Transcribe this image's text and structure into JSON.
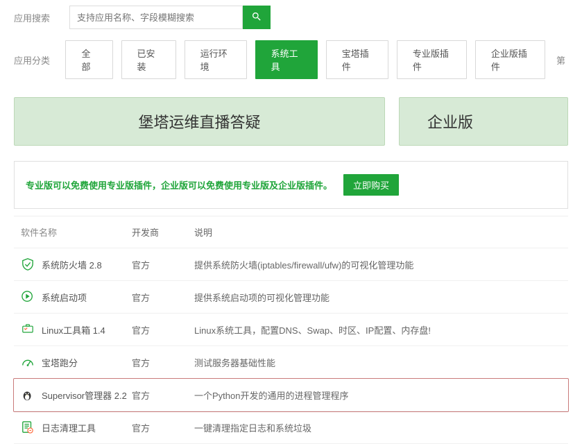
{
  "search": {
    "label": "应用搜索",
    "placeholder": "支持应用名称、字段模糊搜索"
  },
  "categories": {
    "label": "应用分类",
    "items": [
      {
        "label": "全部",
        "active": false
      },
      {
        "label": "已安装",
        "active": false
      },
      {
        "label": "运行环境",
        "active": false
      },
      {
        "label": "系统工具",
        "active": true
      },
      {
        "label": "宝塔插件",
        "active": false
      },
      {
        "label": "专业版插件",
        "active": false
      },
      {
        "label": "企业版插件",
        "active": false
      }
    ],
    "more": "第"
  },
  "banners": {
    "main": "堡塔运维直播答疑",
    "side": "企业版"
  },
  "notice": {
    "text": "专业版可以免费使用专业版插件，企业版可以免费使用专业版及企业版插件。",
    "button": "立即购买"
  },
  "table": {
    "headers": {
      "name": "软件名称",
      "dev": "开发商",
      "desc": "说明"
    },
    "rows": [
      {
        "icon": "shield",
        "name": "系统防火墙 2.8",
        "dev": "官方",
        "desc": "提供系统防火墙(iptables/firewall/ufw)的可视化管理功能"
      },
      {
        "icon": "play",
        "name": "系统启动项",
        "dev": "官方",
        "desc": "提供系统启动项的可视化管理功能"
      },
      {
        "icon": "box",
        "name": "Linux工具箱 1.4",
        "dev": "官方",
        "desc": "Linux系统工具，配置DNS、Swap、时区、IP配置、内存盘!"
      },
      {
        "icon": "gauge",
        "name": "宝塔跑分",
        "dev": "官方",
        "desc": "测试服务器基础性能"
      },
      {
        "icon": "penguin",
        "name": "Supervisor管理器 2.2",
        "dev": "官方",
        "desc": "一个Python开发的通用的进程管理程序",
        "highlight": true
      },
      {
        "icon": "log",
        "name": "日志清理工具",
        "dev": "官方",
        "desc": "一键清理指定日志和系统垃圾"
      }
    ]
  }
}
